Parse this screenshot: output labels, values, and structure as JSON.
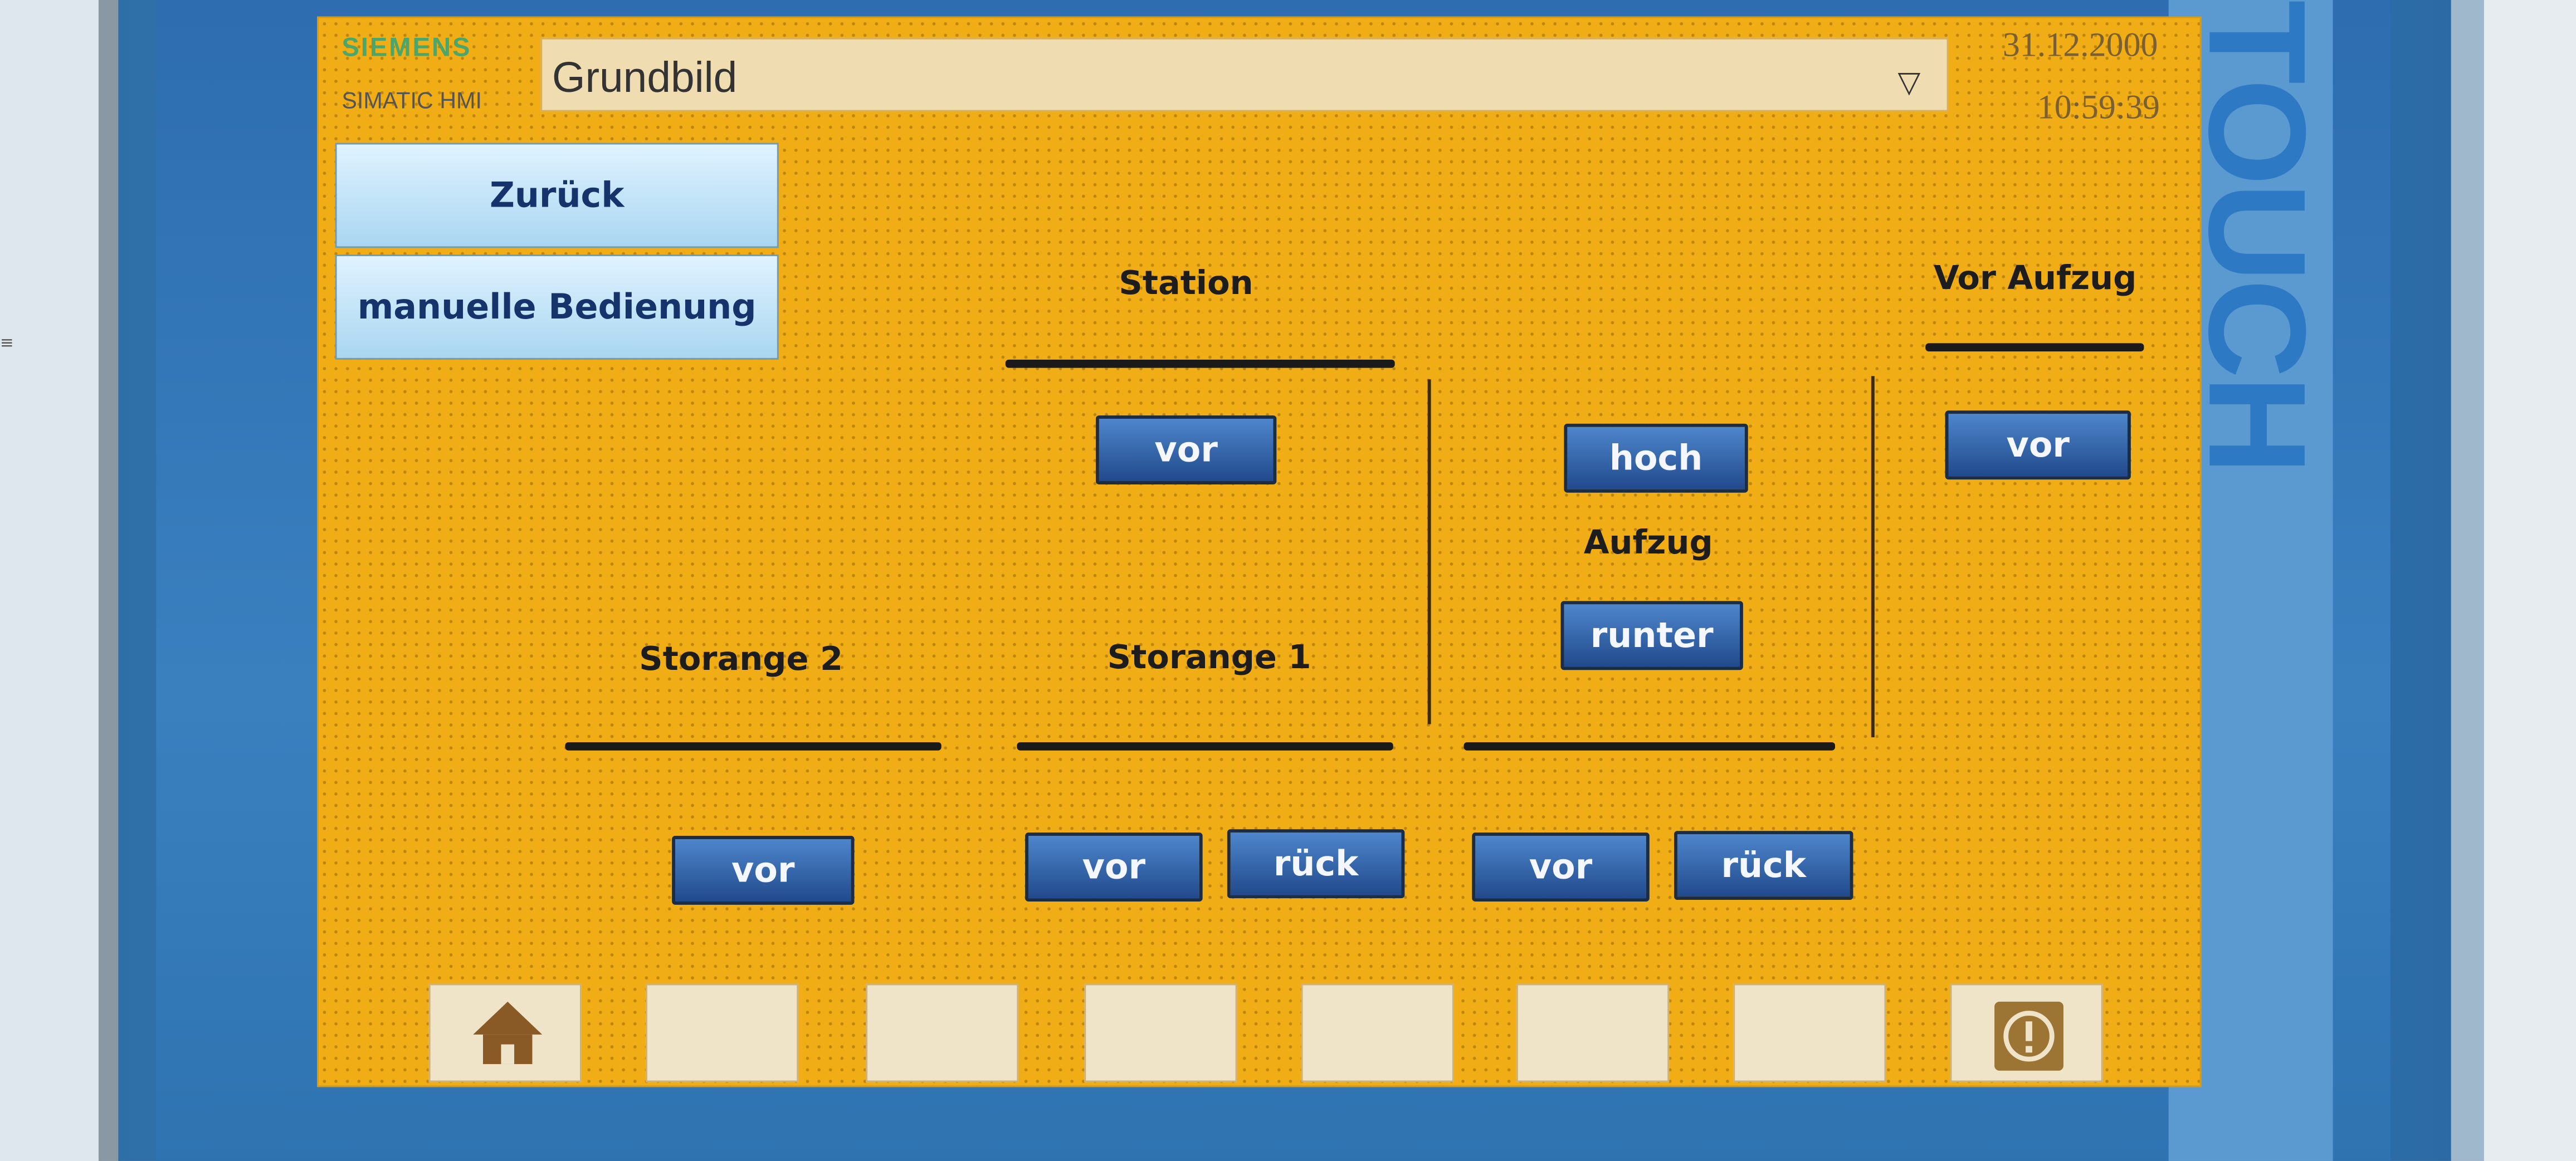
{
  "header": {
    "brand": "SIEMENS",
    "product": "SIMATIC HMI",
    "screen_selector": {
      "value": "Grundbild"
    },
    "date": "31.12.2000",
    "time": "10:59:39"
  },
  "bezel": {
    "brand_text": "TOUCH"
  },
  "nav": {
    "back_label": "Zurück",
    "manual_label": "manuelle Bedienung"
  },
  "sections": {
    "station": {
      "title": "Station",
      "vor": "vor"
    },
    "aufzug": {
      "title": "Aufzug",
      "hoch": "hoch",
      "runter": "runter",
      "vor": "vor",
      "rueck": "rück"
    },
    "vor_aufzug": {
      "title": "Vor Aufzug",
      "vor": "vor"
    },
    "storange2": {
      "title": "Storange 2",
      "vor": "vor"
    },
    "storange1": {
      "title": "Storange 1",
      "vor": "vor",
      "rueck": "rück"
    }
  },
  "function_keys": [
    {
      "icon": "home-icon"
    },
    {
      "icon": ""
    },
    {
      "icon": ""
    },
    {
      "icon": ""
    },
    {
      "icon": ""
    },
    {
      "icon": ""
    },
    {
      "icon": ""
    },
    {
      "icon": "info-icon"
    }
  ],
  "colors": {
    "screen_bg": "#f1ad15",
    "button": "#2d5ea8",
    "nav_button": "#bfe3f7",
    "frame": "#3a80bf"
  }
}
